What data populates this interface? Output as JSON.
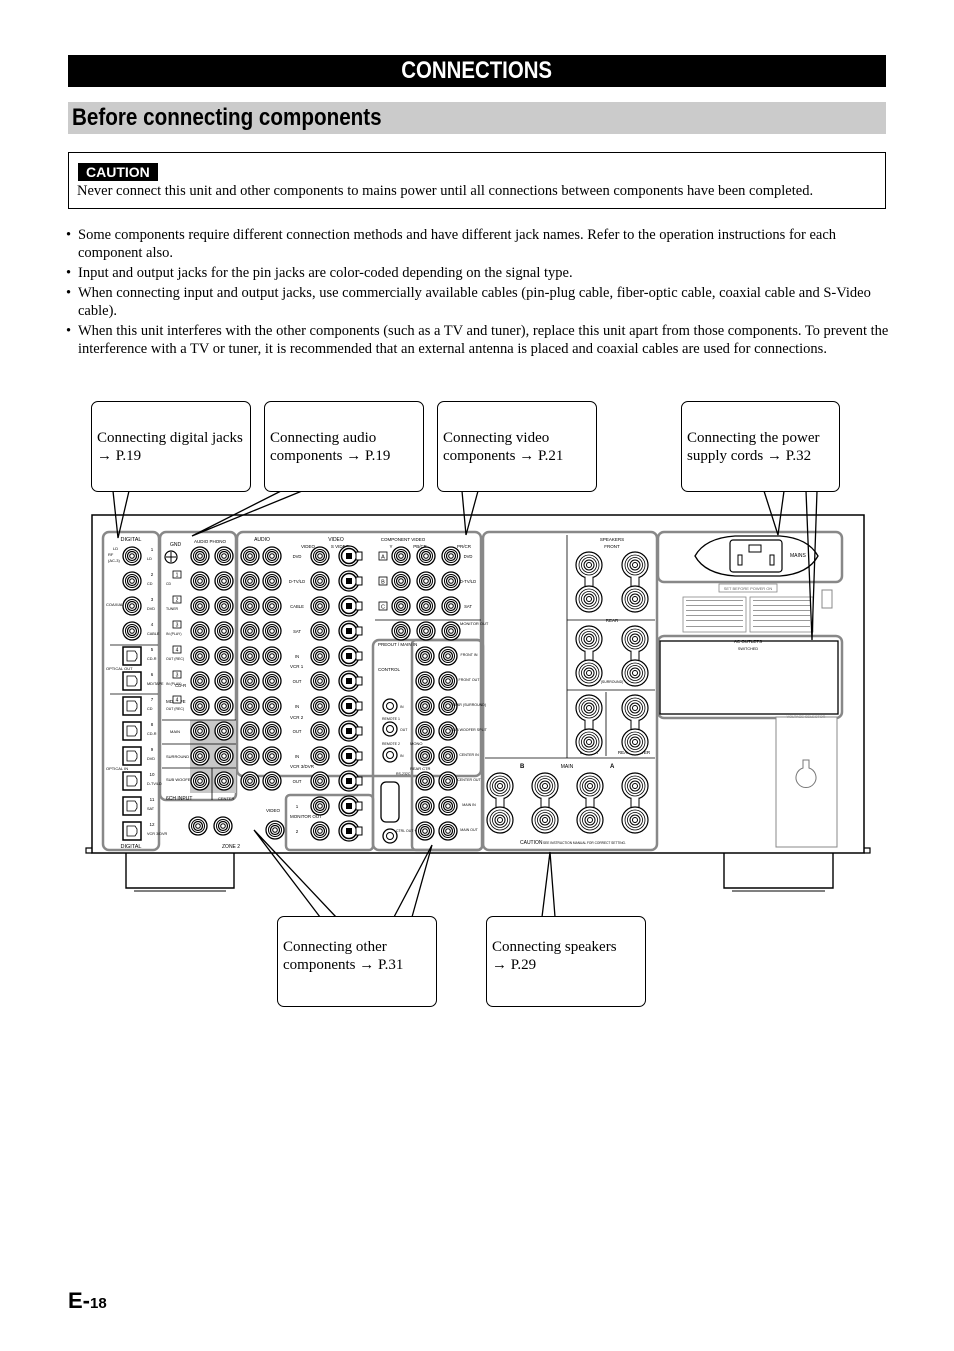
{
  "header": {
    "chapter_title": "CONNECTIONS",
    "section_title": "Before connecting components"
  },
  "caution": {
    "badge": "CAUTION",
    "text": "Never connect this unit and other components to mains power until all connections between components have been completed."
  },
  "bullets": [
    "Some components require different connection methods and have different jack names. Refer to the operation instructions for each component also.",
    "Input and output jacks for the pin jacks are color-coded depending on the signal type.",
    "When connecting input and output jacks, use commercially available cables (pin-plug cable, fiber-optic cable, coaxial cable and S-Video cable).",
    "When this unit interferes with the other components (such as a TV and tuner), replace this unit apart from those components. To prevent the interference with a TV or tuner, it is recommended that an external antenna is placed and coaxial cables are used for connections."
  ],
  "callouts": {
    "digital": {
      "line1": "Connecting digital jacks",
      "line2": "→ P.19"
    },
    "audio": {
      "line1": "Connecting audio",
      "line2": "components → P.19"
    },
    "video": {
      "line1": "Connecting video",
      "line2": "components → P.21"
    },
    "power": {
      "line1": "Connecting the power",
      "line2": "supply cords → P.32"
    },
    "other": {
      "line1": "Connecting other",
      "line2": "components → P.31"
    },
    "speakers": {
      "line1": "Connecting speakers",
      "line2": "→ P.29"
    }
  },
  "panel": {
    "digital": {
      "header": "DIGITAL",
      "footer": "DIGITAL",
      "coaxial_in": "COAXIAL IN",
      "optical_out": "OPTICAL OUT",
      "optical_in": "OPTICAL IN",
      "ld_rf": "LD RF (AC-3)",
      "jacks": [
        {
          "num": "1",
          "label": "LD"
        },
        {
          "num": "2",
          "label": "CD"
        },
        {
          "num": "3",
          "label": "DVD"
        },
        {
          "num": "4",
          "label": "CABLE"
        },
        {
          "num": "5",
          "label": "CD-R"
        },
        {
          "num": "6",
          "label": "MD/TAPE"
        },
        {
          "num": "7",
          "label": "CD"
        },
        {
          "num": "8",
          "label": "CD-R"
        },
        {
          "num": "9",
          "label": "DVD"
        },
        {
          "num": "10",
          "label": "D-TV/LD"
        },
        {
          "num": "11",
          "label": "SAT"
        },
        {
          "num": "12",
          "label": "VCR 3/DVR"
        }
      ]
    },
    "audio_left": {
      "gnd": "GND",
      "phono": "AUDIO PHONO",
      "rows": [
        {
          "num": "1",
          "label": "CD"
        },
        {
          "num": "2",
          "label": "TUNER"
        },
        {
          "num": "3",
          "label": "IN (PLAY)"
        },
        {
          "num": "4",
          "label": "OUT (REC)"
        },
        {
          "num": "3",
          "label": "IN (PLAY)"
        },
        {
          "num": "4",
          "label": "OUT (REC)"
        }
      ],
      "cdr_label": "CD-R",
      "mdtape_label": "MD/TAPE",
      "ch6": [
        "MAIN",
        "SURROUND",
        "SUB WOOFER"
      ],
      "ch6_title": "6CH INPUT",
      "center": "CENTER",
      "zone2": "ZONE 2"
    },
    "av": {
      "audio_header": "AUDIO",
      "video_header": "VIDEO",
      "video_col": "VIDEO",
      "svideo_col": "S VIDEO",
      "rows": [
        "DVD",
        "D-TV/LD",
        "CABLE",
        "SAT",
        "IN",
        "OUT",
        "IN",
        "OUT",
        "IN",
        "OUT"
      ],
      "groups": [
        "VCR 1",
        "VCR 2",
        "VCR 3/DVR"
      ],
      "monitor_out": "MONITOR OUT",
      "monitor_rows": [
        "1",
        "2"
      ],
      "video_label": "VIDEO"
    },
    "component_video": {
      "header": "COMPONENT VIDEO",
      "cols": [
        "Y",
        "PB/CB",
        "PR/CR"
      ],
      "rows": [
        {
          "key": "A",
          "label": "DVD"
        },
        {
          "key": "B",
          "label": "D-TV/LD"
        },
        {
          "key": "C",
          "label": "SAT"
        }
      ],
      "monitor_out": "MONITOR OUT"
    },
    "preout": {
      "header": "PREOUT / MAIN IN",
      "rows": [
        "FRONT IN",
        "FRONT OUT",
        "REAR (SURROUND)",
        "SUB WOOFER SPLIT",
        "CENTER IN",
        "CENTER OUT",
        "MAIN IN",
        "MAIN OUT"
      ],
      "mono": "MONO",
      "rear_ctr": "REAR CTR"
    },
    "control": {
      "header": "CONTROL",
      "remote1": "REMOTE 1",
      "remote2": "REMOTE 2",
      "rs232c": "RS-232C",
      "ctrl_out": "CTRL OUT +12V",
      "in": "IN",
      "out": "OUT"
    },
    "speakers": {
      "header": "SPEAKERS",
      "front": "FRONT",
      "rear": "REAR",
      "surround": "(SURROUND)",
      "center": "CENTER",
      "rear_center": "REAR CENTER",
      "main": "MAIN",
      "a": "A",
      "b": "B",
      "caution": "CAUTION",
      "caution_note": "SEE INSTRUCTION MANUAL FOR CORRECT SETTING."
    },
    "power": {
      "mains": "MAINS",
      "set_before": "SET BEFORE POWER ON",
      "ac_outlets": "AC OUTLETS",
      "switched": "SWITCHED",
      "voltage_selector": "VOLTAGE SELECTOR"
    }
  },
  "footer": {
    "page_prefix": "E-",
    "page_number": "18"
  }
}
